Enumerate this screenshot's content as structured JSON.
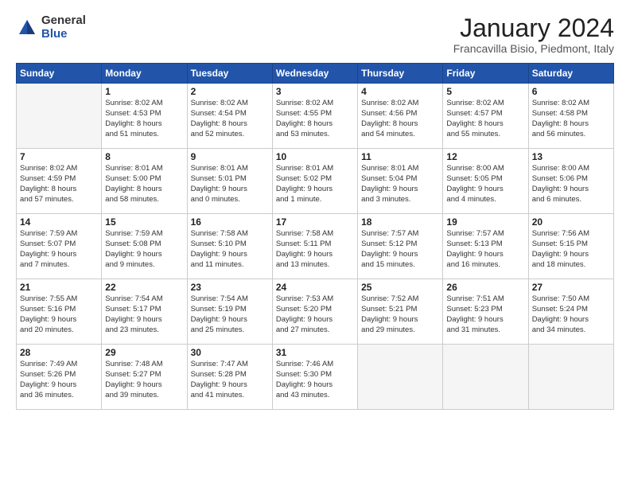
{
  "header": {
    "logo": {
      "general": "General",
      "blue": "Blue"
    },
    "title": "January 2024",
    "location": "Francavilla Bisio, Piedmont, Italy"
  },
  "weekdays": [
    "Sunday",
    "Monday",
    "Tuesday",
    "Wednesday",
    "Thursday",
    "Friday",
    "Saturday"
  ],
  "weeks": [
    [
      {
        "day": "",
        "info": ""
      },
      {
        "day": "1",
        "info": "Sunrise: 8:02 AM\nSunset: 4:53 PM\nDaylight: 8 hours\nand 51 minutes."
      },
      {
        "day": "2",
        "info": "Sunrise: 8:02 AM\nSunset: 4:54 PM\nDaylight: 8 hours\nand 52 minutes."
      },
      {
        "day": "3",
        "info": "Sunrise: 8:02 AM\nSunset: 4:55 PM\nDaylight: 8 hours\nand 53 minutes."
      },
      {
        "day": "4",
        "info": "Sunrise: 8:02 AM\nSunset: 4:56 PM\nDaylight: 8 hours\nand 54 minutes."
      },
      {
        "day": "5",
        "info": "Sunrise: 8:02 AM\nSunset: 4:57 PM\nDaylight: 8 hours\nand 55 minutes."
      },
      {
        "day": "6",
        "info": "Sunrise: 8:02 AM\nSunset: 4:58 PM\nDaylight: 8 hours\nand 56 minutes."
      }
    ],
    [
      {
        "day": "7",
        "info": "Sunrise: 8:02 AM\nSunset: 4:59 PM\nDaylight: 8 hours\nand 57 minutes."
      },
      {
        "day": "8",
        "info": "Sunrise: 8:01 AM\nSunset: 5:00 PM\nDaylight: 8 hours\nand 58 minutes."
      },
      {
        "day": "9",
        "info": "Sunrise: 8:01 AM\nSunset: 5:01 PM\nDaylight: 9 hours\nand 0 minutes."
      },
      {
        "day": "10",
        "info": "Sunrise: 8:01 AM\nSunset: 5:02 PM\nDaylight: 9 hours\nand 1 minute."
      },
      {
        "day": "11",
        "info": "Sunrise: 8:01 AM\nSunset: 5:04 PM\nDaylight: 9 hours\nand 3 minutes."
      },
      {
        "day": "12",
        "info": "Sunrise: 8:00 AM\nSunset: 5:05 PM\nDaylight: 9 hours\nand 4 minutes."
      },
      {
        "day": "13",
        "info": "Sunrise: 8:00 AM\nSunset: 5:06 PM\nDaylight: 9 hours\nand 6 minutes."
      }
    ],
    [
      {
        "day": "14",
        "info": "Sunrise: 7:59 AM\nSunset: 5:07 PM\nDaylight: 9 hours\nand 7 minutes."
      },
      {
        "day": "15",
        "info": "Sunrise: 7:59 AM\nSunset: 5:08 PM\nDaylight: 9 hours\nand 9 minutes."
      },
      {
        "day": "16",
        "info": "Sunrise: 7:58 AM\nSunset: 5:10 PM\nDaylight: 9 hours\nand 11 minutes."
      },
      {
        "day": "17",
        "info": "Sunrise: 7:58 AM\nSunset: 5:11 PM\nDaylight: 9 hours\nand 13 minutes."
      },
      {
        "day": "18",
        "info": "Sunrise: 7:57 AM\nSunset: 5:12 PM\nDaylight: 9 hours\nand 15 minutes."
      },
      {
        "day": "19",
        "info": "Sunrise: 7:57 AM\nSunset: 5:13 PM\nDaylight: 9 hours\nand 16 minutes."
      },
      {
        "day": "20",
        "info": "Sunrise: 7:56 AM\nSunset: 5:15 PM\nDaylight: 9 hours\nand 18 minutes."
      }
    ],
    [
      {
        "day": "21",
        "info": "Sunrise: 7:55 AM\nSunset: 5:16 PM\nDaylight: 9 hours\nand 20 minutes."
      },
      {
        "day": "22",
        "info": "Sunrise: 7:54 AM\nSunset: 5:17 PM\nDaylight: 9 hours\nand 23 minutes."
      },
      {
        "day": "23",
        "info": "Sunrise: 7:54 AM\nSunset: 5:19 PM\nDaylight: 9 hours\nand 25 minutes."
      },
      {
        "day": "24",
        "info": "Sunrise: 7:53 AM\nSunset: 5:20 PM\nDaylight: 9 hours\nand 27 minutes."
      },
      {
        "day": "25",
        "info": "Sunrise: 7:52 AM\nSunset: 5:21 PM\nDaylight: 9 hours\nand 29 minutes."
      },
      {
        "day": "26",
        "info": "Sunrise: 7:51 AM\nSunset: 5:23 PM\nDaylight: 9 hours\nand 31 minutes."
      },
      {
        "day": "27",
        "info": "Sunrise: 7:50 AM\nSunset: 5:24 PM\nDaylight: 9 hours\nand 34 minutes."
      }
    ],
    [
      {
        "day": "28",
        "info": "Sunrise: 7:49 AM\nSunset: 5:26 PM\nDaylight: 9 hours\nand 36 minutes."
      },
      {
        "day": "29",
        "info": "Sunrise: 7:48 AM\nSunset: 5:27 PM\nDaylight: 9 hours\nand 39 minutes."
      },
      {
        "day": "30",
        "info": "Sunrise: 7:47 AM\nSunset: 5:28 PM\nDaylight: 9 hours\nand 41 minutes."
      },
      {
        "day": "31",
        "info": "Sunrise: 7:46 AM\nSunset: 5:30 PM\nDaylight: 9 hours\nand 43 minutes."
      },
      {
        "day": "",
        "info": ""
      },
      {
        "day": "",
        "info": ""
      },
      {
        "day": "",
        "info": ""
      }
    ]
  ]
}
